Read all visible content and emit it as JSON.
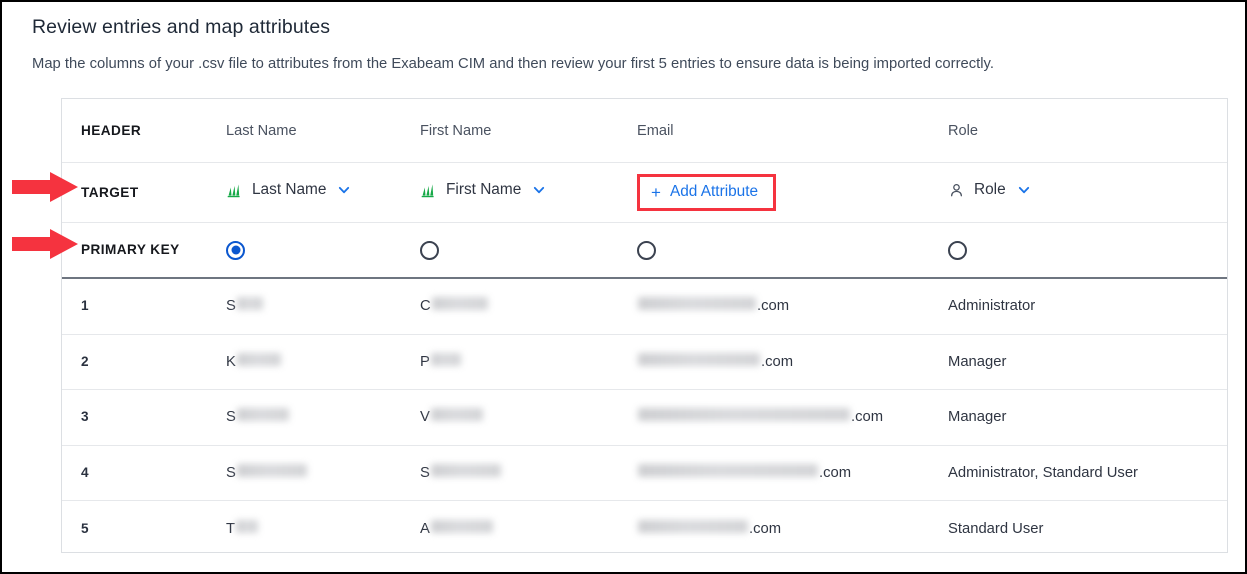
{
  "panel": {
    "title": "Review entries and map attributes",
    "description": "Map the columns of your .csv file to attributes from the Exabeam CIM and then review your first 5 entries to ensure data is being imported correctly."
  },
  "table": {
    "row_labels": {
      "header": "HEADER",
      "target": "TARGET",
      "primary_key": "PRIMARY KEY"
    },
    "columns": [
      {
        "key": "last_name",
        "header": "Last Name"
      },
      {
        "key": "first_name",
        "header": "First Name"
      },
      {
        "key": "email",
        "header": "Email"
      },
      {
        "key": "role",
        "header": "Role"
      }
    ],
    "target_row": [
      {
        "kind": "mapped",
        "icon": "column-chart-icon",
        "label": "Last Name",
        "caret": "chevron-down-icon"
      },
      {
        "kind": "mapped",
        "icon": "column-chart-icon",
        "label": "First Name",
        "caret": "chevron-down-icon"
      },
      {
        "kind": "add",
        "icon": "plus-icon",
        "label": "Add Attribute",
        "highlighted": true
      },
      {
        "kind": "mapped",
        "icon": "person-icon",
        "label": "Role",
        "caret": "chevron-down-icon"
      }
    ],
    "primary_key_row": [
      {
        "selected": true
      },
      {
        "selected": false
      },
      {
        "selected": false
      },
      {
        "selected": false
      }
    ],
    "entries": [
      {
        "num": "1",
        "last_name_visible": "S",
        "last_name_redacted_width": 26,
        "first_name_visible": "C",
        "first_name_redacted_width": 56,
        "email_redacted_width": 118,
        "email_suffix": ".com",
        "role": "Administrator"
      },
      {
        "num": "2",
        "last_name_visible": "K",
        "last_name_redacted_width": 44,
        "first_name_visible": "P",
        "first_name_redacted_width": 30,
        "email_redacted_width": 122,
        "email_suffix": ".com",
        "role": "Manager"
      },
      {
        "num": "3",
        "last_name_visible": "S",
        "last_name_redacted_width": 52,
        "first_name_visible": "V",
        "first_name_redacted_width": 52,
        "email_redacted_width": 212,
        "email_suffix": ".com",
        "role": "Manager"
      },
      {
        "num": "4",
        "last_name_visible": "S",
        "last_name_redacted_width": 70,
        "first_name_visible": "S",
        "first_name_redacted_width": 70,
        "email_redacted_width": 180,
        "email_suffix": ".com",
        "role": "Administrator, Standard User"
      },
      {
        "num": "5",
        "last_name_visible": "T",
        "last_name_redacted_width": 22,
        "first_name_visible": "A",
        "first_name_redacted_width": 62,
        "email_redacted_width": 110,
        "email_suffix": ".com",
        "role": "Standard User"
      }
    ]
  },
  "annotations": {
    "arrows": [
      {
        "name": "arrow-target",
        "points_to": "TARGET"
      },
      {
        "name": "arrow-primary-key",
        "points_to": "PRIMARY KEY"
      }
    ],
    "highlight_box": {
      "target": "Add Attribute",
      "color": "#f5333f"
    }
  },
  "colors": {
    "link_blue": "#1a73e8",
    "radio_selected": "#0b57cf",
    "highlight_red": "#f5333f",
    "attribute_icon_green": "#17a948",
    "border_gray": "#dcdfe3"
  }
}
